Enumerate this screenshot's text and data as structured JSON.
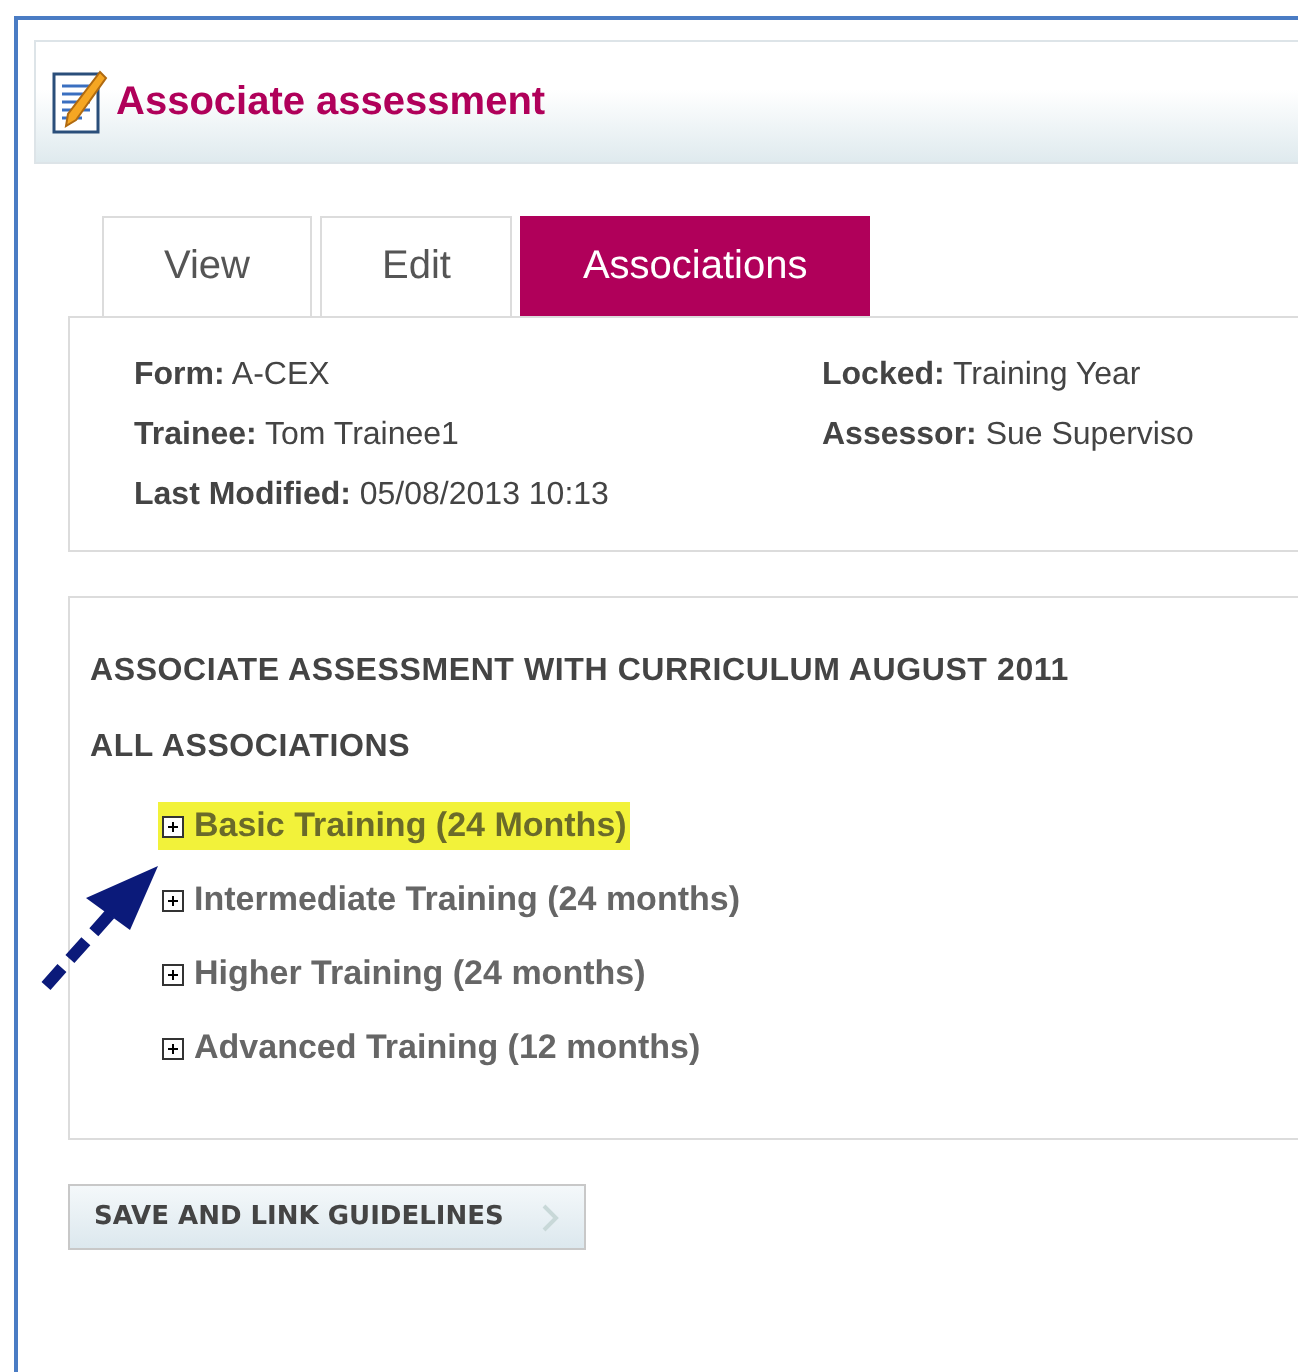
{
  "header": {
    "title": "Associate assessment"
  },
  "tabs": [
    {
      "label": "View",
      "selected": false
    },
    {
      "label": "Edit",
      "selected": false
    },
    {
      "label": "Associations",
      "selected": true
    }
  ],
  "details": [
    {
      "label": "Form:",
      "value": "A-CEX"
    },
    {
      "label": "Locked:",
      "value": "Training Year"
    },
    {
      "label": "Trainee:",
      "value": "Tom Trainee1"
    },
    {
      "label": "Assessor:",
      "value": "Sue Superviso"
    },
    {
      "label": "Last Modified:",
      "value": "05/08/2013 10:13"
    }
  ],
  "section": {
    "heading": "ASSOCIATE ASSESSMENT WITH CURRICULUM AUGUST 2011",
    "subheading": "ALL ASSOCIATIONS"
  },
  "tree": [
    {
      "label": "Basic Training (24 Months)",
      "expanded": false,
      "highlighted": true
    },
    {
      "label": "Intermediate Training (24 months)",
      "expanded": false,
      "highlighted": false
    },
    {
      "label": "Higher Training (24 months)",
      "expanded": false,
      "highlighted": false
    },
    {
      "label": "Advanced Training (12 months)",
      "expanded": false,
      "highlighted": false
    }
  ],
  "button": {
    "label": "SAVE AND LINK GUIDELINES"
  }
}
